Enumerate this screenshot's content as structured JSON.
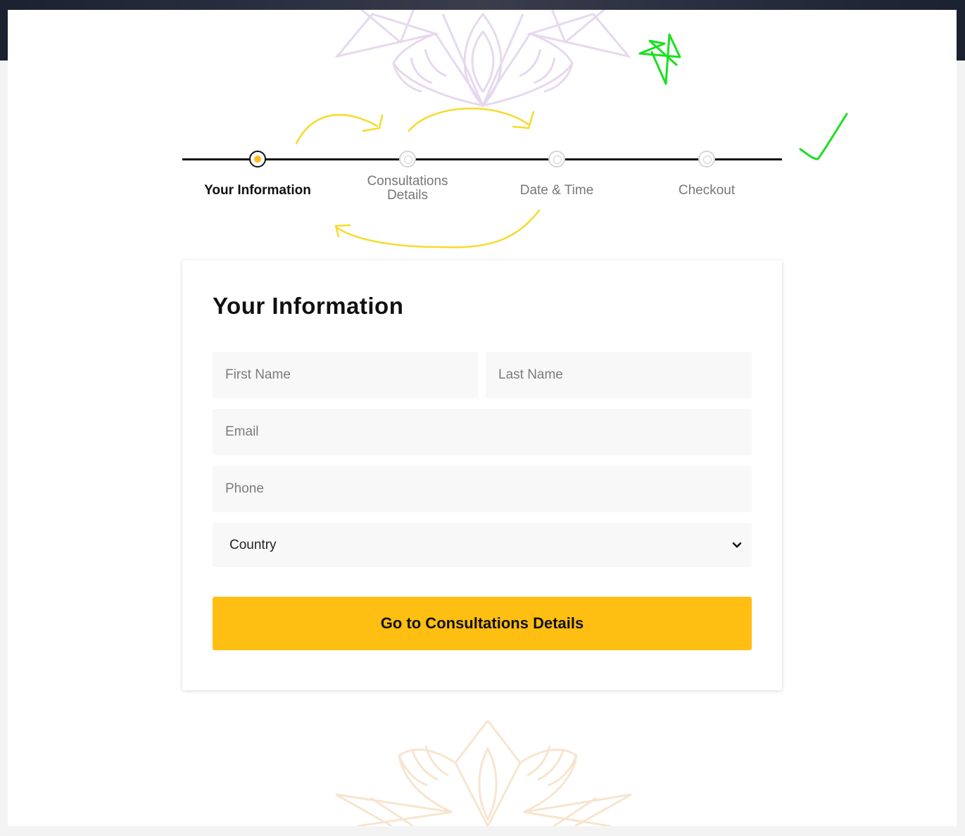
{
  "colors": {
    "accent": "#ffbe12",
    "active_dot": "#ffbe16",
    "annotation_yellow": "#f5dc2a",
    "annotation_green": "#19e01f",
    "mandala_top": "#e6d9ee",
    "mandala_bottom": "#f7e5cf"
  },
  "stepper": {
    "steps": [
      {
        "label": "Your Information",
        "state": "active"
      },
      {
        "label": "Consultations Details",
        "state": "inactive"
      },
      {
        "label": "Date & Time",
        "state": "inactive"
      },
      {
        "label": "Checkout",
        "state": "inactive"
      }
    ]
  },
  "form": {
    "title": "Your Information",
    "first_name": {
      "placeholder": "First Name",
      "value": ""
    },
    "last_name": {
      "placeholder": "Last Name",
      "value": ""
    },
    "email": {
      "placeholder": "Email",
      "value": ""
    },
    "phone": {
      "placeholder": "Phone",
      "value": ""
    },
    "country": {
      "selected": "Country",
      "icon": "chevron-down-icon"
    },
    "submit_label": "Go to Consultations Details"
  }
}
